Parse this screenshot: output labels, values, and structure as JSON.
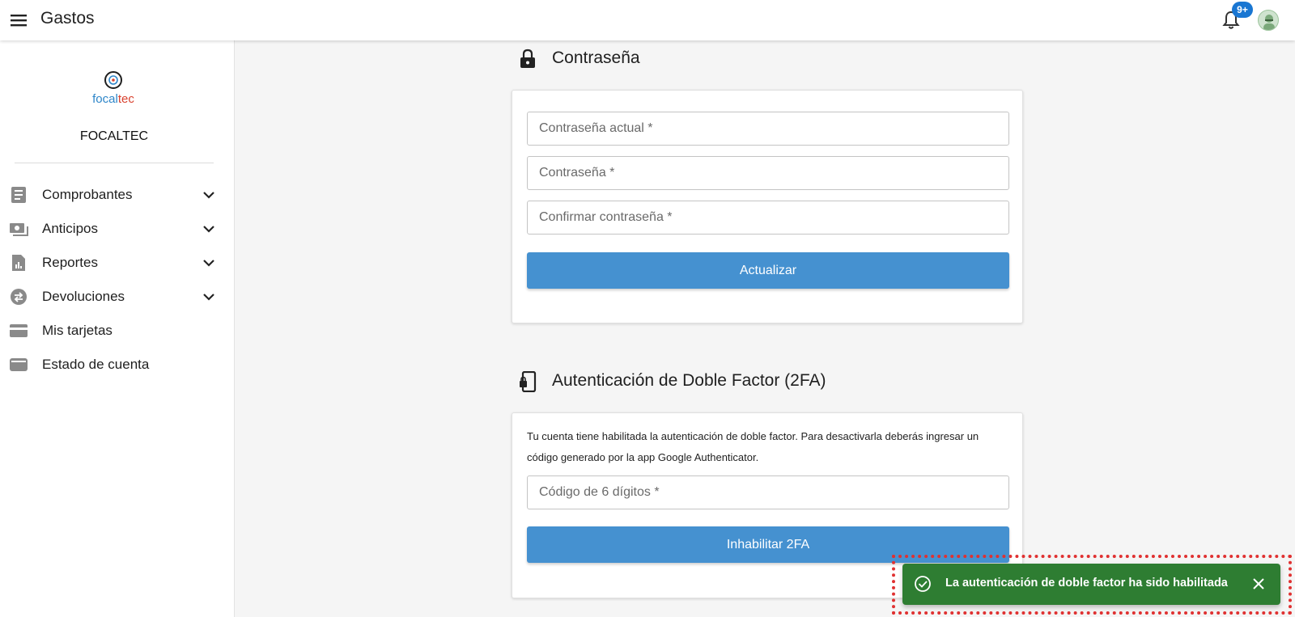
{
  "appbar": {
    "title": "Gastos",
    "notification_badge": "9+",
    "icons": [
      "menu-icon",
      "bell-icon",
      "avatar"
    ]
  },
  "sidebar": {
    "logo": {
      "focal": "focal",
      "tec": "tec"
    },
    "org_name": "FOCALTEC",
    "items": [
      {
        "label": "Comprobantes",
        "icon": "receipt-icon",
        "expandable": true
      },
      {
        "label": "Anticipos",
        "icon": "money-icon",
        "expandable": true
      },
      {
        "label": "Reportes",
        "icon": "report-icon",
        "expandable": true
      },
      {
        "label": "Devoluciones",
        "icon": "exchange-icon",
        "expandable": true
      },
      {
        "label": "Mis tarjetas",
        "icon": "card-icon",
        "expandable": false
      },
      {
        "label": "Estado de cuenta",
        "icon": "wallet-icon",
        "expandable": false
      }
    ]
  },
  "password_section": {
    "title": "Contraseña",
    "icon": "lock-icon",
    "current_placeholder": "Contraseña actual *",
    "new_placeholder": "Contraseña *",
    "confirm_placeholder": "Confirmar contraseña *",
    "submit_label": "Actualizar"
  },
  "twofa_section": {
    "title": "Autenticación de Doble Factor (2FA)",
    "icon": "phone-lock-icon",
    "description": "Tu cuenta tiene habilitada la autenticación de doble factor. Para desactivarla deberás ingresar un código generado por la app Google Authenticator.",
    "code_placeholder": "Código de 6 dígitos *",
    "submit_label": "Inhabilitar 2FA"
  },
  "toast": {
    "message": "La autenticación de doble factor ha sido habilitada",
    "icon": "check-circle-icon",
    "close_icon": "close-icon"
  },
  "colors": {
    "primary_button": "#4591d0",
    "toast_success": "#2e7d32",
    "badge": "#1976d2",
    "highlight": "#e03131"
  }
}
